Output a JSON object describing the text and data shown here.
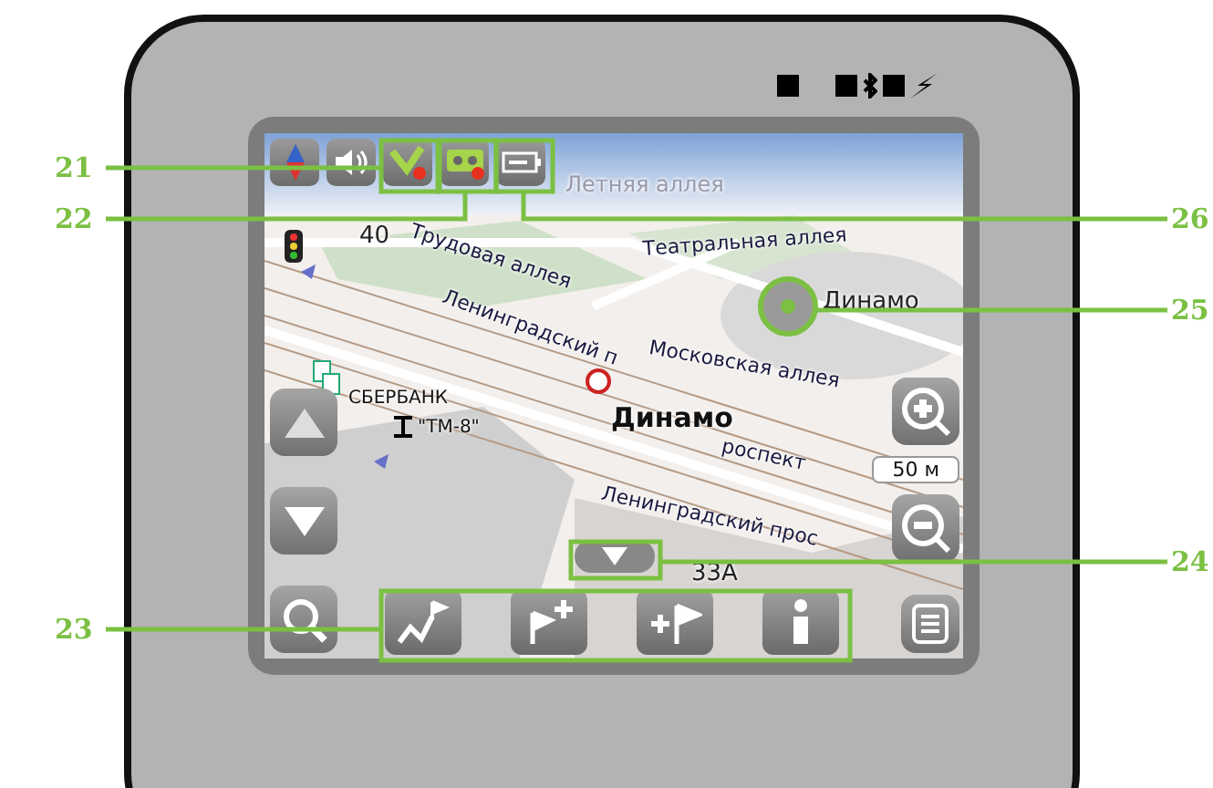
{
  "map": {
    "labels": [
      {
        "text": "Летняя аллея",
        "kind": "faint"
      },
      {
        "text": "40",
        "kind": "plain"
      },
      {
        "text": "Трудовая аллея",
        "kind": "street"
      },
      {
        "text": "Театральная аллея",
        "kind": "street"
      },
      {
        "text": "Динамо",
        "kind": "plain"
      },
      {
        "text": "Московская аллея",
        "kind": "street"
      },
      {
        "text": "Ленинградский п",
        "kind": "street"
      },
      {
        "text": "Динамо",
        "kind": "bold"
      },
      {
        "text": "роспект",
        "kind": "street"
      },
      {
        "text": "СБЕРБАНК",
        "kind": "small"
      },
      {
        "text": "\"ТМ-8\"",
        "kind": "small"
      },
      {
        "text": "Ленинградский прос",
        "kind": "street"
      },
      {
        "text": "33А",
        "kind": "plain"
      }
    ],
    "scale": "50 м"
  },
  "callouts": [
    {
      "number": "21"
    },
    {
      "number": "22"
    },
    {
      "number": "23"
    },
    {
      "number": "26"
    },
    {
      "number": "25"
    },
    {
      "number": "24"
    }
  ]
}
